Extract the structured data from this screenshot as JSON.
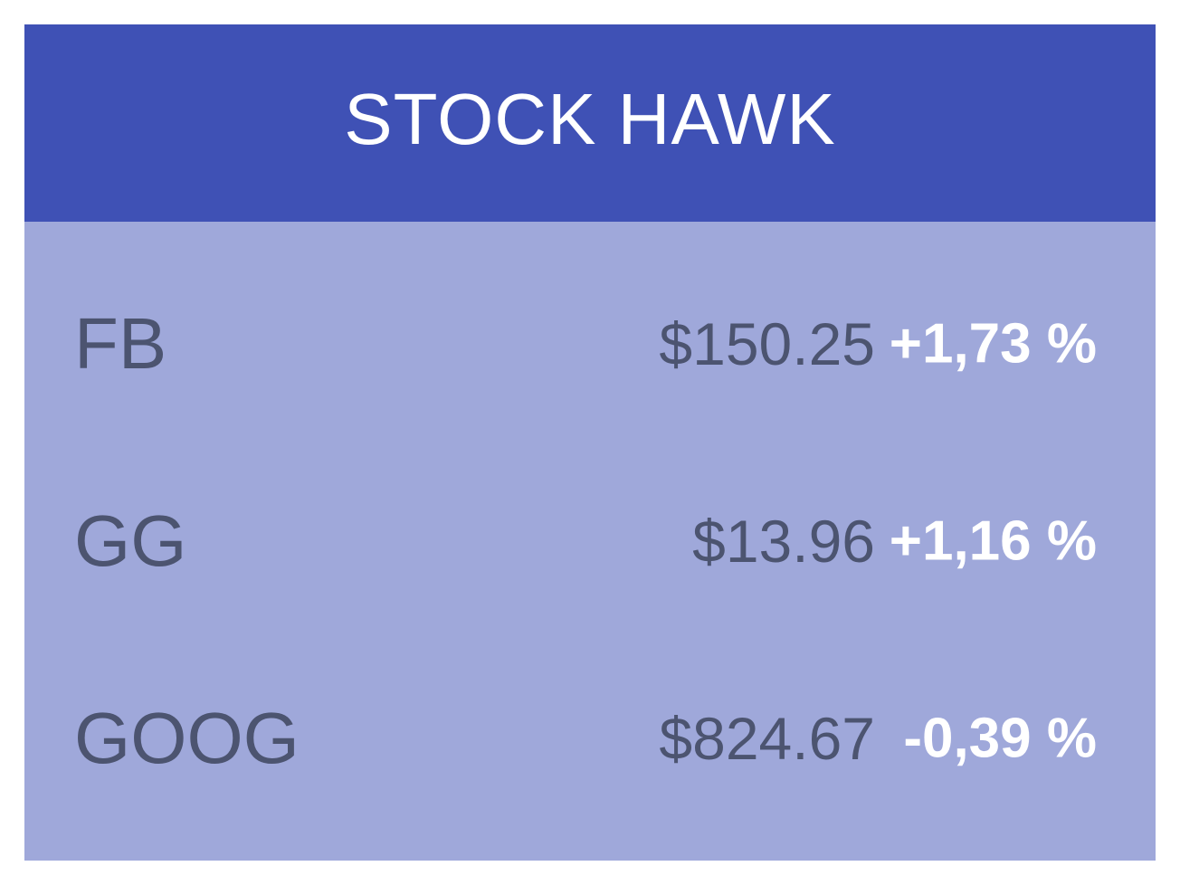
{
  "app": {
    "title": "STOCK HAWK",
    "colors": {
      "header_bg": "#3f51b5",
      "list_bg": "#9fa8da",
      "symbol_text": "#4c5470",
      "change_text": "#ffffff"
    }
  },
  "stocks": [
    {
      "symbol": "FB",
      "price": "$150.25",
      "change": "+1,73 %"
    },
    {
      "symbol": "GG",
      "price": "$13.96",
      "change": "+1,16 %"
    },
    {
      "symbol": "GOOG",
      "price": "$824.67",
      "change": "-0,39 %"
    }
  ]
}
